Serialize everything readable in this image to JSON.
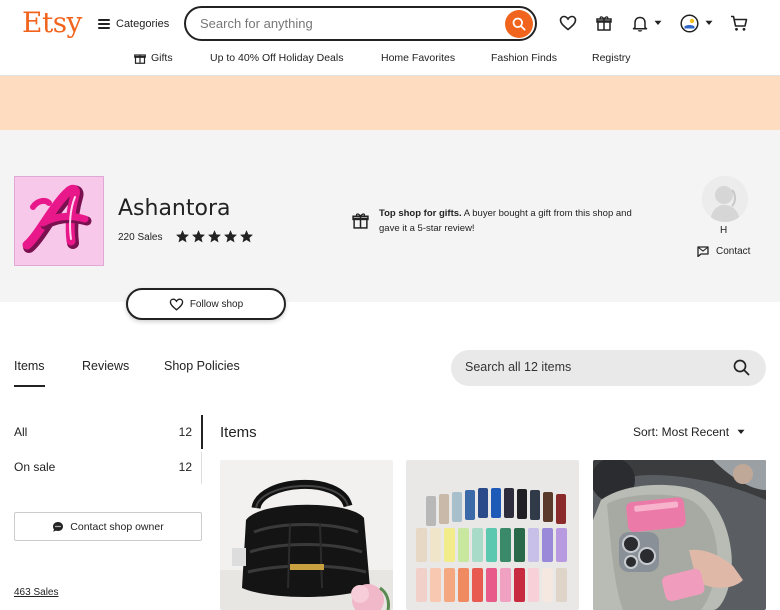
{
  "header": {
    "logo": "Etsy",
    "categories_label": "Categories",
    "search_placeholder": "Search for anything"
  },
  "subnav": [
    {
      "label": "Gifts"
    },
    {
      "label": "Up to 40% Off Holiday Deals"
    },
    {
      "label": "Home Favorites"
    },
    {
      "label": "Fashion Finds"
    },
    {
      "label": "Registry"
    }
  ],
  "colors": {
    "brand": "#f1641e",
    "banner": "#fddcc0",
    "shop_bg": "#f4f4f4",
    "logo_bg": "#f8c8ea",
    "logo_letter": "#e8188a"
  },
  "shop": {
    "name": "Ashantora",
    "sales": "220 Sales",
    "rating_stars": 5,
    "logo_letter": "A",
    "top_shop_bold": "Top shop for gifts.",
    "top_shop_text": "A buyer bought a gift from this shop and gave it a 5-star review!",
    "owner_name": "H",
    "contact_label": "Contact",
    "follow_label": "Follow shop"
  },
  "tabs": [
    {
      "label": "Items",
      "active": true
    },
    {
      "label": "Reviews",
      "active": false
    },
    {
      "label": "Shop Policies",
      "active": false
    }
  ],
  "shop_search_placeholder": "Search all 12 items",
  "sidebar": {
    "items": [
      {
        "label": "All",
        "count": "12"
      },
      {
        "label": "On sale",
        "count": "12"
      }
    ],
    "contact_owner_label": "Contact shop owner",
    "sales_link": "463 Sales"
  },
  "main": {
    "title": "Items",
    "sort_label": "Sort: Most Recent"
  },
  "icons": [
    "search-icon",
    "heart-icon",
    "gift-icon",
    "bell-icon",
    "account-icon",
    "cart-icon",
    "message-icon",
    "chat-icon",
    "chevron-down-icon",
    "star-icon"
  ]
}
